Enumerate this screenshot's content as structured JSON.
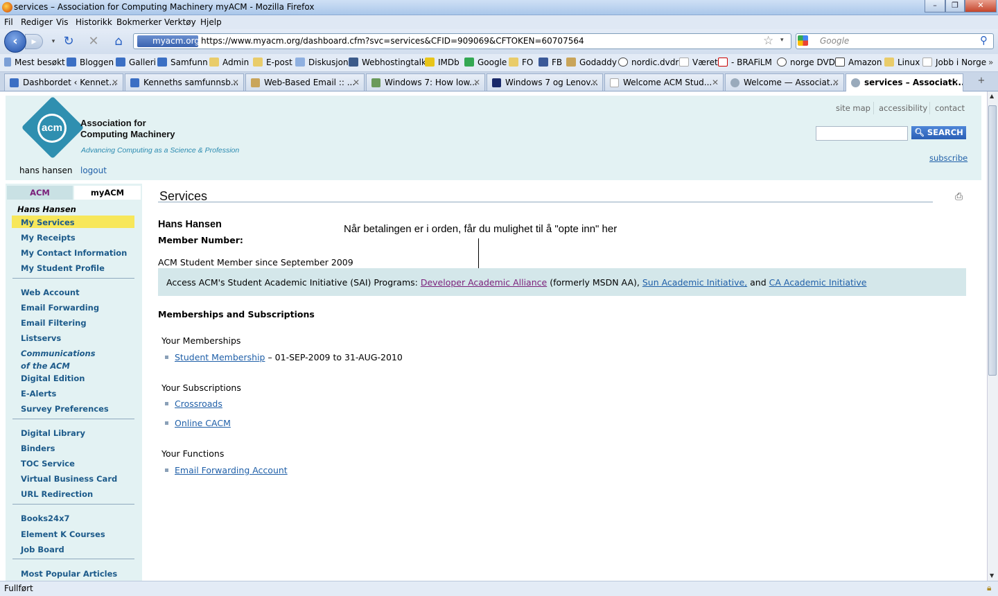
{
  "window": {
    "title": "services – Association for Computing Machinery myACM - Mozilla Firefox"
  },
  "menu": [
    "Fil",
    "Rediger",
    "Vis",
    "Historikk",
    "Bokmerker",
    "Verktøy",
    "Hjelp"
  ],
  "nav": {
    "site_identity": "myacm.org",
    "url": "https://www.myacm.org/dashboard.cfm?svc=services&CFID=909069&CFTOKEN=60707564",
    "search_placeholder": "Google"
  },
  "bookmarks": [
    "Mest besøkt",
    "Bloggen",
    "Galleri",
    "Samfunn",
    "Admin",
    "E-post",
    "Diskusjon",
    "Webhostingtalk",
    "IMDb",
    "Google",
    "FO",
    "FB",
    "Godaddy",
    "nordic.dvdr",
    "Været",
    "- BRAFiLM",
    "norge DVD",
    "Amazon",
    "Linux",
    "Jobb i Norge"
  ],
  "tabs": [
    "Dashbordet ‹ Kennet...",
    "Kenneths samfunnsb...",
    "Web-Based Email :: ...",
    "Windows 7: How low...",
    "Windows 7 og Lenov...",
    "Welcome ACM Stud...",
    "Welcome — Associat...",
    "services – Associati..."
  ],
  "header": {
    "logo_text": "acm",
    "org_line1": "Association for",
    "org_line2": "Computing Machinery",
    "tagline": "Advancing Computing as a Science & Profession",
    "user_name": "hans hansen",
    "logout": "logout",
    "links": [
      "site map",
      "accessibility",
      "contact"
    ],
    "search_button": "SEARCH",
    "subscribe": "subscribe"
  },
  "sidebar": {
    "tab_acm": "ACM",
    "tab_myacm": "myACM",
    "user": "Hans Hansen",
    "groups": [
      [
        "My Services",
        "My Receipts",
        "My Contact Information",
        "My Student Profile"
      ],
      [
        "Web Account",
        "Email Forwarding",
        "Email Filtering",
        "Listservs",
        "Communications",
        "of the ACM",
        "Digital Edition",
        "E-Alerts",
        "Survey Preferences"
      ],
      [
        "Digital Library",
        "Binders",
        "TOC Service",
        "Virtual Business Card",
        "URL Redirection"
      ],
      [
        "Books24x7",
        "Element K Courses",
        "Job Board"
      ],
      [
        "Most Popular Articles"
      ]
    ]
  },
  "main": {
    "title": "Services",
    "member_name": "Hans Hansen",
    "member_number_label": "Member Number:",
    "since": "ACM Student Member since September 2009",
    "annotation": "Når betalingen er i orden, får du mulighet til å \"opte inn\" her",
    "sai_prefix": "Access ACM's Student Academic Initiative (SAI) Programs:",
    "sai_link1": "Developer Academic Alliance",
    "sai_mid": "(formerly MSDN AA),",
    "sai_link2": "Sun Academic Initiative,",
    "sai_and": "and",
    "sai_link3": "CA Academic Initiative",
    "section_title": "Memberships and Subscriptions",
    "memberships_label": "Your Memberships",
    "membership_link": "Student Membership",
    "membership_dates": "– 01-SEP-2009 to 31-AUG-2010",
    "subscriptions_label": "Your Subscriptions",
    "subscriptions": [
      "Crossroads",
      "Online CACM"
    ],
    "functions_label": "Your Functions",
    "functions": [
      "Email Forwarding Account"
    ]
  },
  "status": "Fullført",
  "colors": {
    "accent": "#2f8fb0",
    "sidebar_bg": "#e3f2f3",
    "highlight": "#f7e75a",
    "link": "#1f5fa8"
  }
}
